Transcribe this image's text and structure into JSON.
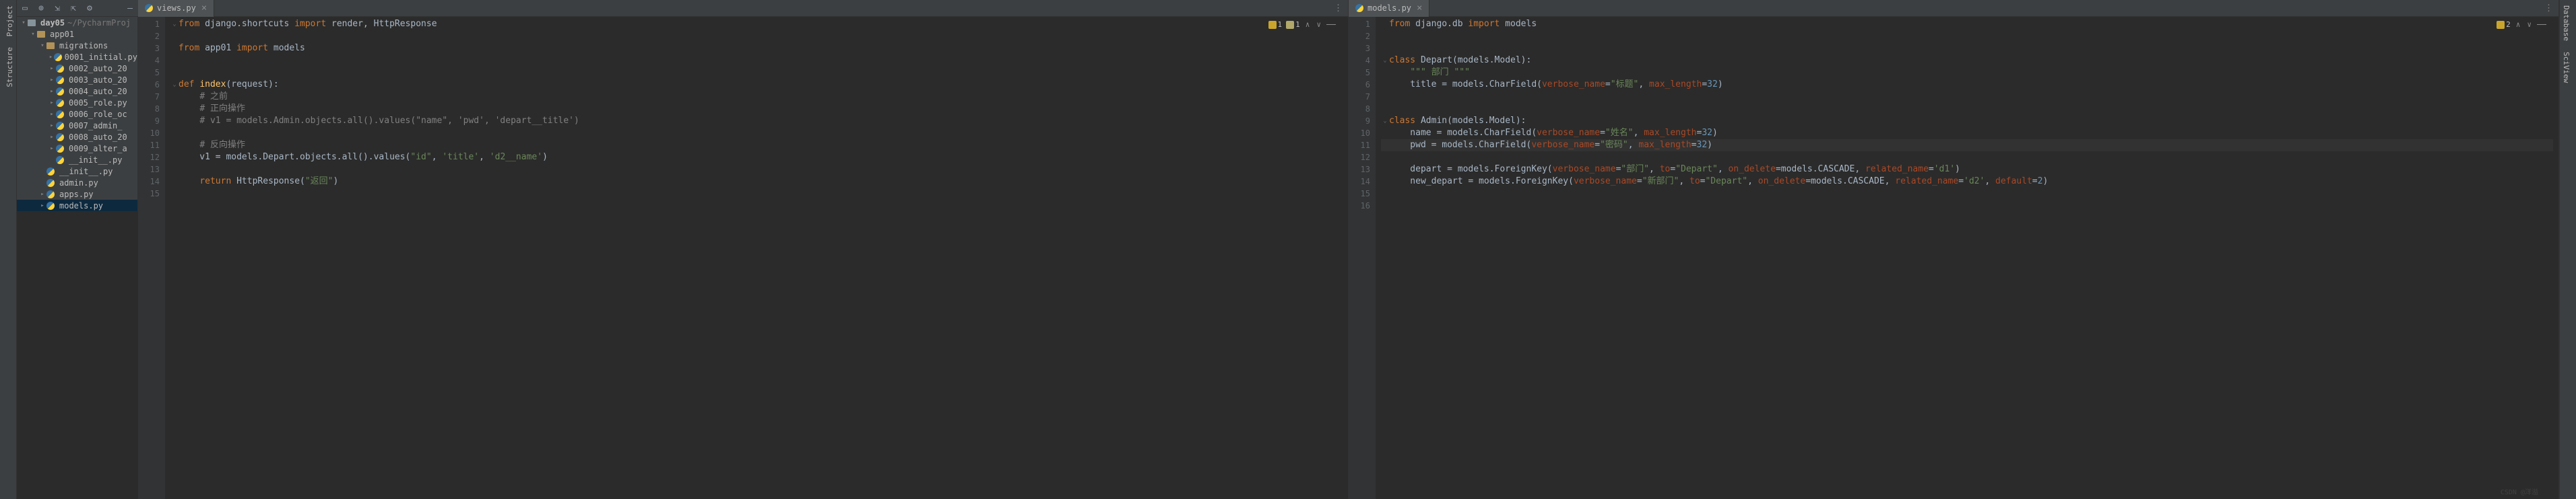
{
  "left_tools": [
    "Project",
    "Structure"
  ],
  "right_tools": [
    "Database",
    "SciView"
  ],
  "project_tree": {
    "root": {
      "name": "day05",
      "path": "~/PycharmProj"
    },
    "app01": "app01",
    "migrations": "migrations",
    "migration_files": [
      "0001_initial.py",
      "0002_auto_20",
      "0003_auto_20",
      "0004_auto_20",
      "0005_role.py",
      "0006_role_oc",
      "0007_admin_",
      "0008_auto_20",
      "0009_alter_a"
    ],
    "init_mig": "__init__.py",
    "init_app": "__init__.py",
    "admin": "admin.py",
    "apps": "apps.py",
    "models": "models.py"
  },
  "tabs": {
    "left": "views.py",
    "right": "models.py"
  },
  "inspections": {
    "left": {
      "warn1": "1",
      "warn2": "1"
    },
    "right": {
      "warn1": "2"
    }
  },
  "code_left": {
    "lines": [
      {
        "n": 1,
        "f": "⌄",
        "t": [
          [
            "kw",
            "from"
          ],
          [
            "",
            " django.shortcuts "
          ],
          [
            "kw",
            "import"
          ],
          [
            "",
            " render"
          ],
          [
            "",
            ", HttpResponse"
          ]
        ]
      },
      {
        "n": 2,
        "t": []
      },
      {
        "n": 3,
        "t": [
          [
            "kw",
            "from"
          ],
          [
            "",
            " app01 "
          ],
          [
            "kw",
            "import"
          ],
          [
            "",
            " models"
          ]
        ]
      },
      {
        "n": 4,
        "t": []
      },
      {
        "n": 5,
        "t": []
      },
      {
        "n": 6,
        "f": "⌄",
        "t": [
          [
            "kw",
            "def "
          ],
          [
            "fn",
            "index"
          ],
          [
            "",
            "(request):"
          ]
        ]
      },
      {
        "n": 7,
        "t": [
          [
            "",
            "    "
          ],
          [
            "com",
            "# 之前"
          ]
        ]
      },
      {
        "n": 8,
        "t": [
          [
            "",
            "    "
          ],
          [
            "com",
            "# 正向操作"
          ]
        ]
      },
      {
        "n": 9,
        "t": [
          [
            "",
            "    "
          ],
          [
            "com",
            "# v1 = models.Admin.objects.all().values(\"name\", 'pwd', 'depart__title')"
          ]
        ]
      },
      {
        "n": 10,
        "t": []
      },
      {
        "n": 11,
        "t": [
          [
            "",
            "    "
          ],
          [
            "com",
            "# 反向操作"
          ]
        ]
      },
      {
        "n": 12,
        "t": [
          [
            "",
            "    v1 = models.Depart.objects.all().values("
          ],
          [
            "str",
            "\"id\""
          ],
          [
            "",
            ", "
          ],
          [
            "str",
            "'title'"
          ],
          [
            "",
            ", "
          ],
          [
            "str",
            "'d2__name'"
          ],
          [
            "",
            ")"
          ]
        ]
      },
      {
        "n": 13,
        "t": []
      },
      {
        "n": 14,
        "t": [
          [
            "",
            "    "
          ],
          [
            "kw",
            "return"
          ],
          [
            "",
            " HttpResponse("
          ],
          [
            "str",
            "\"返回\""
          ],
          [
            "",
            ")"
          ]
        ]
      },
      {
        "n": 15,
        "t": []
      }
    ]
  },
  "code_right": {
    "caret_line": 11,
    "lines": [
      {
        "n": 1,
        "t": [
          [
            "kw",
            "from"
          ],
          [
            "",
            " django.db "
          ],
          [
            "kw",
            "import"
          ],
          [
            "",
            " models"
          ]
        ]
      },
      {
        "n": 2,
        "t": []
      },
      {
        "n": 3,
        "t": []
      },
      {
        "n": 4,
        "f": "⌄",
        "t": [
          [
            "kw",
            "class "
          ],
          [
            "cls",
            "Depart"
          ],
          [
            "",
            "(models.Model):"
          ]
        ]
      },
      {
        "n": 5,
        "t": [
          [
            "",
            "    "
          ],
          [
            "str",
            "\"\"\" 部门 \"\"\""
          ]
        ]
      },
      {
        "n": 6,
        "t": [
          [
            "",
            "    title = models.CharField("
          ],
          [
            "param",
            "verbose_name"
          ],
          [
            "",
            "="
          ],
          [
            "str",
            "\"标题\""
          ],
          [
            "",
            ", "
          ],
          [
            "param",
            "max_length"
          ],
          [
            "",
            "="
          ],
          [
            "num",
            "32"
          ],
          [
            "",
            ")"
          ]
        ]
      },
      {
        "n": 7,
        "t": []
      },
      {
        "n": 8,
        "t": []
      },
      {
        "n": 9,
        "f": "⌄",
        "t": [
          [
            "kw",
            "class "
          ],
          [
            "cls",
            "Admin"
          ],
          [
            "",
            "(models.Model):"
          ]
        ]
      },
      {
        "n": 10,
        "t": [
          [
            "",
            "    name = models.CharField("
          ],
          [
            "param",
            "verbose_name"
          ],
          [
            "",
            "="
          ],
          [
            "str",
            "\"姓名\""
          ],
          [
            "",
            ", "
          ],
          [
            "param",
            "max_length"
          ],
          [
            "",
            "="
          ],
          [
            "num",
            "32"
          ],
          [
            "",
            ")"
          ]
        ]
      },
      {
        "n": 11,
        "t": [
          [
            "",
            "    pwd = models.CharField("
          ],
          [
            "param",
            "verbose_name"
          ],
          [
            "",
            "="
          ],
          [
            "str",
            "\"密码\""
          ],
          [
            "",
            ", "
          ],
          [
            "param",
            "max_length"
          ],
          [
            "",
            "="
          ],
          [
            "num",
            "32"
          ],
          [
            "",
            ")"
          ]
        ]
      },
      {
        "n": 12,
        "t": []
      },
      {
        "n": 13,
        "t": [
          [
            "",
            "    depart = models.ForeignKey("
          ],
          [
            "param",
            "verbose_name"
          ],
          [
            "",
            "="
          ],
          [
            "str",
            "\"部门\""
          ],
          [
            "",
            ", "
          ],
          [
            "param",
            "to"
          ],
          [
            "",
            "="
          ],
          [
            "str",
            "\"Depart\""
          ],
          [
            "",
            ", "
          ],
          [
            "param",
            "on_delete"
          ],
          [
            "",
            "=models.CASCADE, "
          ],
          [
            "param",
            "related_name"
          ],
          [
            "",
            "="
          ],
          [
            "str",
            "'d1'"
          ],
          [
            "",
            ")"
          ]
        ]
      },
      {
        "n": 14,
        "t": [
          [
            "",
            "    new_depart = models.ForeignKey("
          ],
          [
            "param",
            "verbose_name"
          ],
          [
            "",
            "="
          ],
          [
            "str",
            "\"新部门\""
          ],
          [
            "",
            ", "
          ],
          [
            "param",
            "to"
          ],
          [
            "",
            "="
          ],
          [
            "str",
            "\"Depart\""
          ],
          [
            "",
            ", "
          ],
          [
            "param",
            "on_delete"
          ],
          [
            "",
            "=models.CASCADE, "
          ],
          [
            "param",
            "related_name"
          ],
          [
            "",
            "="
          ],
          [
            "str",
            "'d2'"
          ],
          [
            "",
            ", "
          ],
          [
            "param",
            "default"
          ],
          [
            "",
            "="
          ],
          [
            "num",
            "2"
          ],
          [
            "",
            ")"
          ]
        ]
      },
      {
        "n": 15,
        "t": []
      },
      {
        "n": 16,
        "t": []
      }
    ]
  },
  "watermark": "CSDN @洋溢"
}
